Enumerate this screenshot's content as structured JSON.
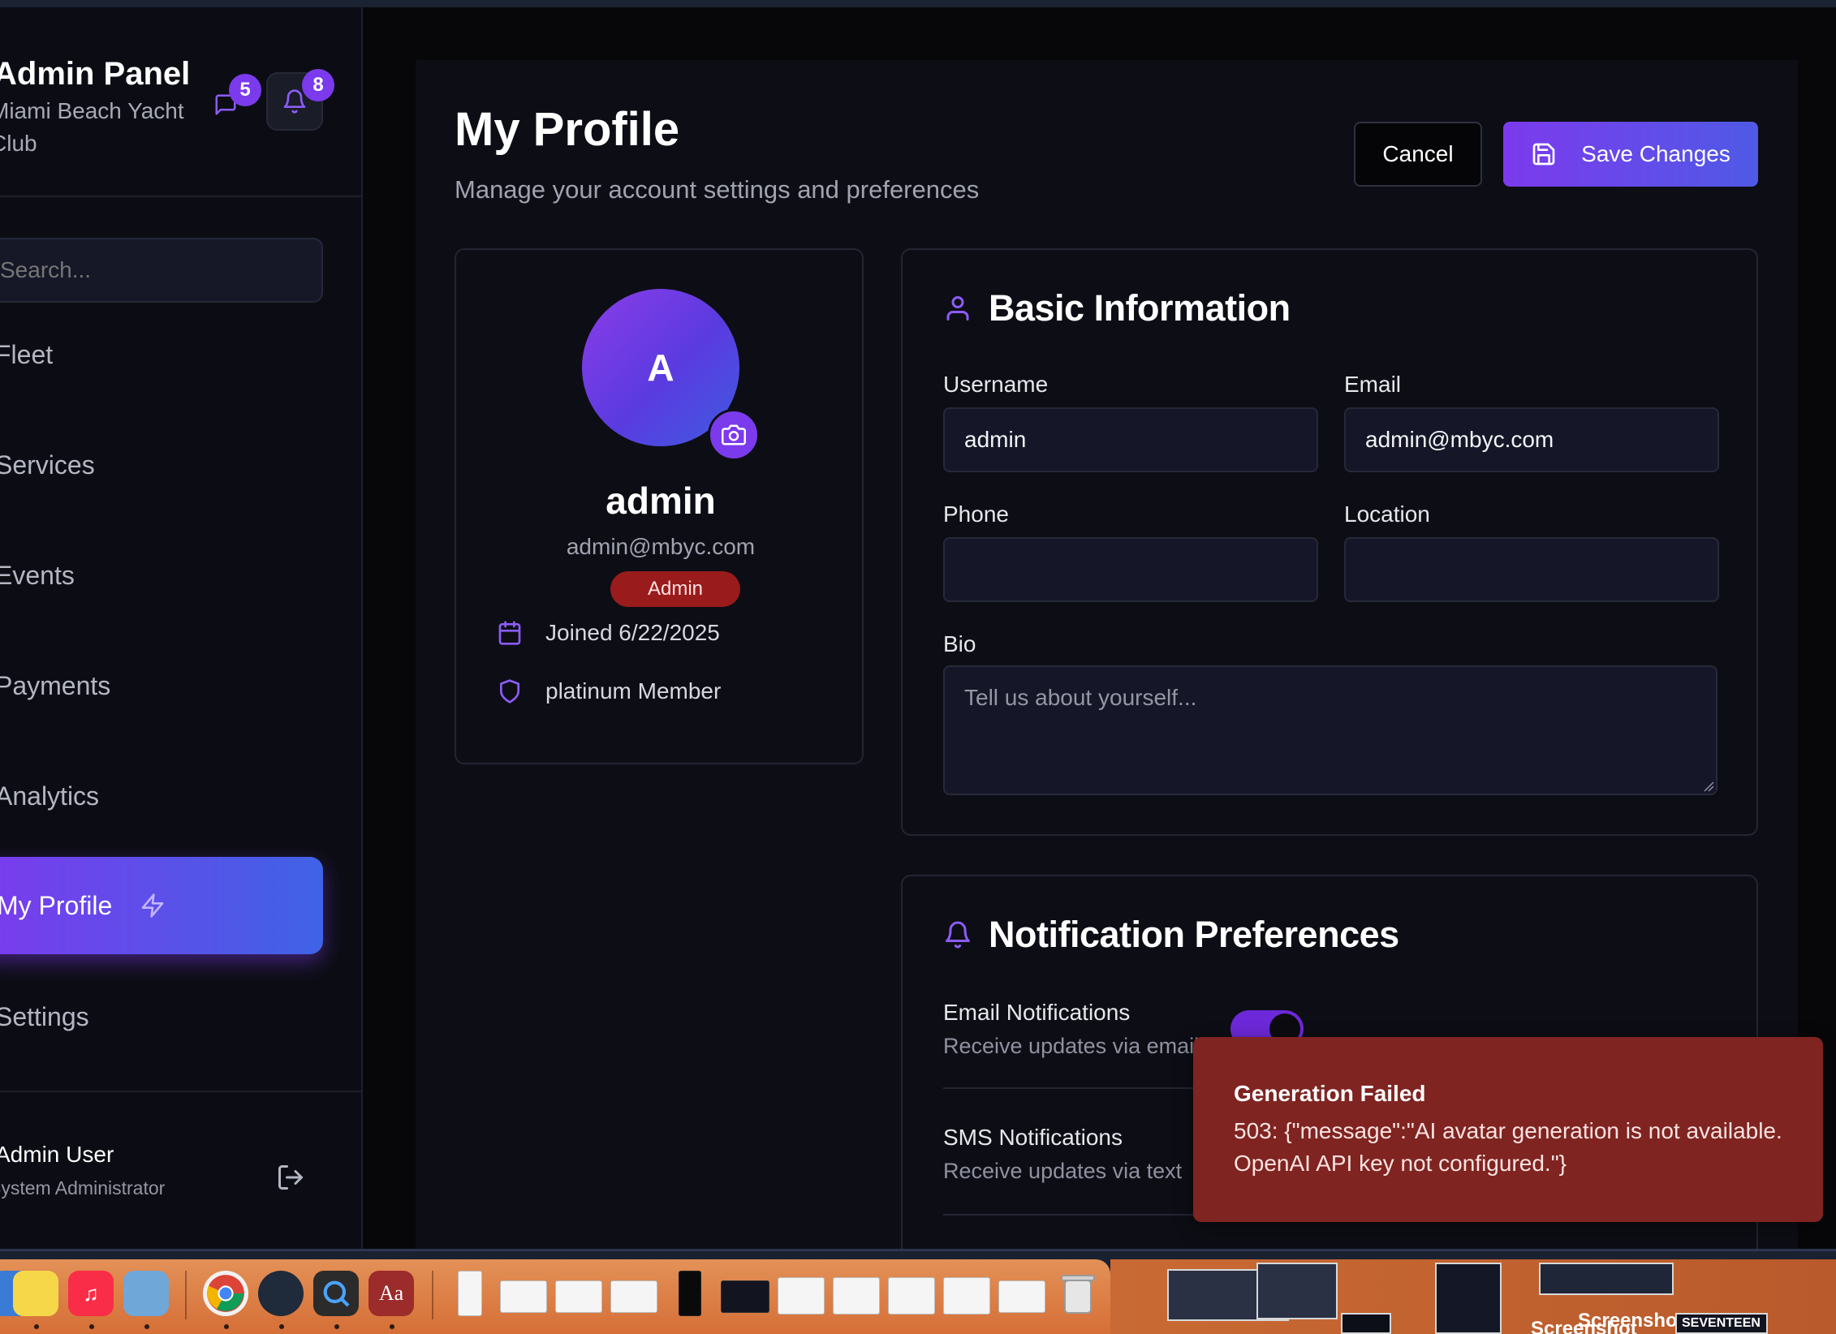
{
  "sidebar": {
    "title": "Admin Panel",
    "subtitle": "Miami Beach Yacht Club",
    "message_count": "5",
    "notification_count": "8",
    "search_placeholder": "Search...",
    "nav": [
      "Fleet",
      "Services",
      "Events",
      "Payments",
      "Analytics",
      "My Profile",
      "Settings"
    ],
    "active_item": "My Profile",
    "user_name": "Admin User",
    "user_role": "System Administrator"
  },
  "header": {
    "title": "My Profile",
    "subtitle": "Manage your account settings and preferences",
    "cancel_label": "Cancel",
    "save_label": "Save Changes"
  },
  "profile_card": {
    "avatar_initial": "A",
    "name": "admin",
    "email": "admin@mbyc.com",
    "role_badge": "Admin",
    "joined": "Joined 6/22/2025",
    "membership": "platinum Member"
  },
  "basic_info": {
    "title": "Basic Information",
    "username_label": "Username",
    "username_value": "admin",
    "email_label": "Email",
    "email_value": "admin@mbyc.com",
    "phone_label": "Phone",
    "phone_value": "",
    "location_label": "Location",
    "location_value": "",
    "bio_label": "Bio",
    "bio_placeholder": "Tell us about yourself..."
  },
  "notifications": {
    "title": "Notification Preferences",
    "email_title": "Email Notifications",
    "email_sub": "Receive updates via email",
    "email_enabled": true,
    "sms_title": "SMS Notifications",
    "sms_sub": "Receive updates via text"
  },
  "toast": {
    "title": "Generation Failed",
    "message": "503: {\"message\":\"AI avatar generation is not available. OpenAI API key not configured.\"}"
  },
  "dock": {
    "dictionary_label": "Aa",
    "screenshot_label_1": "Screenshot",
    "screenshot_label_2": "Screenshot",
    "seventeen_label": "SEVENTEEN"
  },
  "colors": {
    "accent": "#7c3aed",
    "accent_blue": "#3f63e6",
    "danger_badge": "#991b1b",
    "toast_bg": "#7f2421",
    "background": "#0d0e15"
  }
}
